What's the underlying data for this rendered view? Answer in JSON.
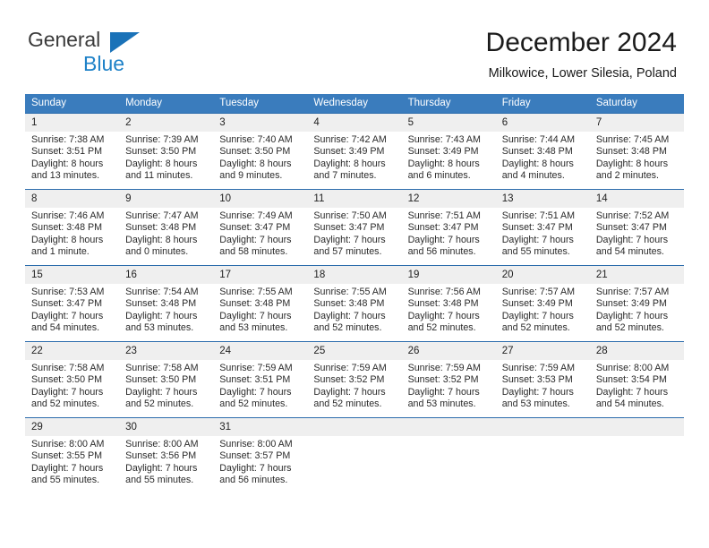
{
  "brand": {
    "name_line1": "General",
    "name_line2": "Blue",
    "accent_color": "#1f82c8",
    "triangle_color": "#1a72b8"
  },
  "header": {
    "title": "December 2024",
    "subtitle": "Milkowice, Lower Silesia, Poland"
  },
  "colors": {
    "header_row_bg": "#3a7cbd",
    "week_divider": "#2b6cac",
    "daynum_bg": "#efefef"
  },
  "weekday_headers": [
    "Sunday",
    "Monday",
    "Tuesday",
    "Wednesday",
    "Thursday",
    "Friday",
    "Saturday"
  ],
  "labels": {
    "sunrise_prefix": "Sunrise:",
    "sunset_prefix": "Sunset:",
    "daylight_prefix": "Daylight:"
  },
  "weeks": [
    [
      {
        "day": "1",
        "sunrise": "Sunrise: 7:38 AM",
        "sunset": "Sunset: 3:51 PM",
        "daylight1": "Daylight: 8 hours",
        "daylight2": "and 13 minutes."
      },
      {
        "day": "2",
        "sunrise": "Sunrise: 7:39 AM",
        "sunset": "Sunset: 3:50 PM",
        "daylight1": "Daylight: 8 hours",
        "daylight2": "and 11 minutes."
      },
      {
        "day": "3",
        "sunrise": "Sunrise: 7:40 AM",
        "sunset": "Sunset: 3:50 PM",
        "daylight1": "Daylight: 8 hours",
        "daylight2": "and 9 minutes."
      },
      {
        "day": "4",
        "sunrise": "Sunrise: 7:42 AM",
        "sunset": "Sunset: 3:49 PM",
        "daylight1": "Daylight: 8 hours",
        "daylight2": "and 7 minutes."
      },
      {
        "day": "5",
        "sunrise": "Sunrise: 7:43 AM",
        "sunset": "Sunset: 3:49 PM",
        "daylight1": "Daylight: 8 hours",
        "daylight2": "and 6 minutes."
      },
      {
        "day": "6",
        "sunrise": "Sunrise: 7:44 AM",
        "sunset": "Sunset: 3:48 PM",
        "daylight1": "Daylight: 8 hours",
        "daylight2": "and 4 minutes."
      },
      {
        "day": "7",
        "sunrise": "Sunrise: 7:45 AM",
        "sunset": "Sunset: 3:48 PM",
        "daylight1": "Daylight: 8 hours",
        "daylight2": "and 2 minutes."
      }
    ],
    [
      {
        "day": "8",
        "sunrise": "Sunrise: 7:46 AM",
        "sunset": "Sunset: 3:48 PM",
        "daylight1": "Daylight: 8 hours",
        "daylight2": "and 1 minute."
      },
      {
        "day": "9",
        "sunrise": "Sunrise: 7:47 AM",
        "sunset": "Sunset: 3:48 PM",
        "daylight1": "Daylight: 8 hours",
        "daylight2": "and 0 minutes."
      },
      {
        "day": "10",
        "sunrise": "Sunrise: 7:49 AM",
        "sunset": "Sunset: 3:47 PM",
        "daylight1": "Daylight: 7 hours",
        "daylight2": "and 58 minutes."
      },
      {
        "day": "11",
        "sunrise": "Sunrise: 7:50 AM",
        "sunset": "Sunset: 3:47 PM",
        "daylight1": "Daylight: 7 hours",
        "daylight2": "and 57 minutes."
      },
      {
        "day": "12",
        "sunrise": "Sunrise: 7:51 AM",
        "sunset": "Sunset: 3:47 PM",
        "daylight1": "Daylight: 7 hours",
        "daylight2": "and 56 minutes."
      },
      {
        "day": "13",
        "sunrise": "Sunrise: 7:51 AM",
        "sunset": "Sunset: 3:47 PM",
        "daylight1": "Daylight: 7 hours",
        "daylight2": "and 55 minutes."
      },
      {
        "day": "14",
        "sunrise": "Sunrise: 7:52 AM",
        "sunset": "Sunset: 3:47 PM",
        "daylight1": "Daylight: 7 hours",
        "daylight2": "and 54 minutes."
      }
    ],
    [
      {
        "day": "15",
        "sunrise": "Sunrise: 7:53 AM",
        "sunset": "Sunset: 3:47 PM",
        "daylight1": "Daylight: 7 hours",
        "daylight2": "and 54 minutes."
      },
      {
        "day": "16",
        "sunrise": "Sunrise: 7:54 AM",
        "sunset": "Sunset: 3:48 PM",
        "daylight1": "Daylight: 7 hours",
        "daylight2": "and 53 minutes."
      },
      {
        "day": "17",
        "sunrise": "Sunrise: 7:55 AM",
        "sunset": "Sunset: 3:48 PM",
        "daylight1": "Daylight: 7 hours",
        "daylight2": "and 53 minutes."
      },
      {
        "day": "18",
        "sunrise": "Sunrise: 7:55 AM",
        "sunset": "Sunset: 3:48 PM",
        "daylight1": "Daylight: 7 hours",
        "daylight2": "and 52 minutes."
      },
      {
        "day": "19",
        "sunrise": "Sunrise: 7:56 AM",
        "sunset": "Sunset: 3:48 PM",
        "daylight1": "Daylight: 7 hours",
        "daylight2": "and 52 minutes."
      },
      {
        "day": "20",
        "sunrise": "Sunrise: 7:57 AM",
        "sunset": "Sunset: 3:49 PM",
        "daylight1": "Daylight: 7 hours",
        "daylight2": "and 52 minutes."
      },
      {
        "day": "21",
        "sunrise": "Sunrise: 7:57 AM",
        "sunset": "Sunset: 3:49 PM",
        "daylight1": "Daylight: 7 hours",
        "daylight2": "and 52 minutes."
      }
    ],
    [
      {
        "day": "22",
        "sunrise": "Sunrise: 7:58 AM",
        "sunset": "Sunset: 3:50 PM",
        "daylight1": "Daylight: 7 hours",
        "daylight2": "and 52 minutes."
      },
      {
        "day": "23",
        "sunrise": "Sunrise: 7:58 AM",
        "sunset": "Sunset: 3:50 PM",
        "daylight1": "Daylight: 7 hours",
        "daylight2": "and 52 minutes."
      },
      {
        "day": "24",
        "sunrise": "Sunrise: 7:59 AM",
        "sunset": "Sunset: 3:51 PM",
        "daylight1": "Daylight: 7 hours",
        "daylight2": "and 52 minutes."
      },
      {
        "day": "25",
        "sunrise": "Sunrise: 7:59 AM",
        "sunset": "Sunset: 3:52 PM",
        "daylight1": "Daylight: 7 hours",
        "daylight2": "and 52 minutes."
      },
      {
        "day": "26",
        "sunrise": "Sunrise: 7:59 AM",
        "sunset": "Sunset: 3:52 PM",
        "daylight1": "Daylight: 7 hours",
        "daylight2": "and 53 minutes."
      },
      {
        "day": "27",
        "sunrise": "Sunrise: 7:59 AM",
        "sunset": "Sunset: 3:53 PM",
        "daylight1": "Daylight: 7 hours",
        "daylight2": "and 53 minutes."
      },
      {
        "day": "28",
        "sunrise": "Sunrise: 8:00 AM",
        "sunset": "Sunset: 3:54 PM",
        "daylight1": "Daylight: 7 hours",
        "daylight2": "and 54 minutes."
      }
    ],
    [
      {
        "day": "29",
        "sunrise": "Sunrise: 8:00 AM",
        "sunset": "Sunset: 3:55 PM",
        "daylight1": "Daylight: 7 hours",
        "daylight2": "and 55 minutes."
      },
      {
        "day": "30",
        "sunrise": "Sunrise: 8:00 AM",
        "sunset": "Sunset: 3:56 PM",
        "daylight1": "Daylight: 7 hours",
        "daylight2": "and 55 minutes."
      },
      {
        "day": "31",
        "sunrise": "Sunrise: 8:00 AM",
        "sunset": "Sunset: 3:57 PM",
        "daylight1": "Daylight: 7 hours",
        "daylight2": "and 56 minutes."
      },
      {
        "day": "",
        "sunrise": "",
        "sunset": "",
        "daylight1": "",
        "daylight2": ""
      },
      {
        "day": "",
        "sunrise": "",
        "sunset": "",
        "daylight1": "",
        "daylight2": ""
      },
      {
        "day": "",
        "sunrise": "",
        "sunset": "",
        "daylight1": "",
        "daylight2": ""
      },
      {
        "day": "",
        "sunrise": "",
        "sunset": "",
        "daylight1": "",
        "daylight2": ""
      }
    ]
  ]
}
